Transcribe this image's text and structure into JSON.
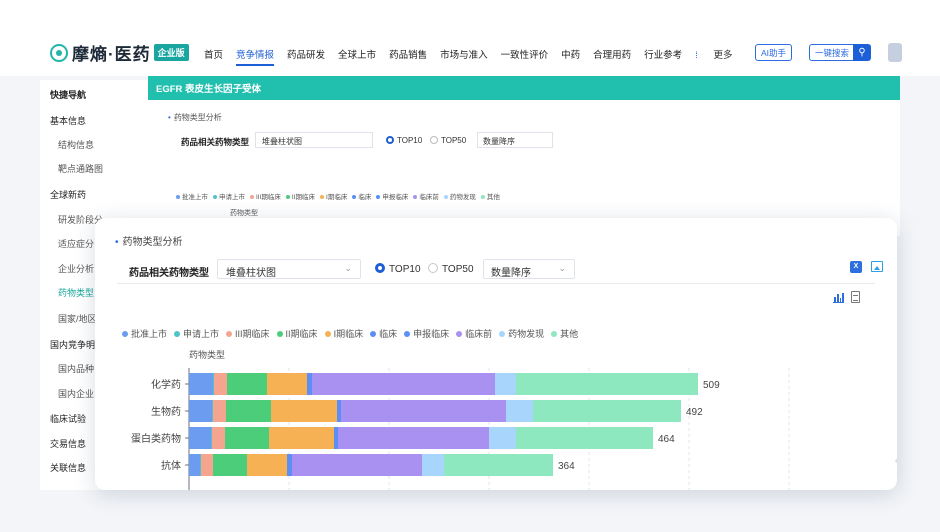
{
  "brand": {
    "name": "摩熵·医药",
    "badge": "企业版"
  },
  "nav": {
    "items": [
      "首页",
      "竞争情报",
      "药品研发",
      "全球上市",
      "药品销售",
      "市场与准入",
      "一致性评价",
      "中药",
      "合理用药",
      "行业参考"
    ],
    "active_index": 1,
    "more_label": "更多"
  },
  "header_actions": {
    "ai_label": "AI助手",
    "search_label": "一键搜索"
  },
  "sidebar": {
    "items": [
      {
        "label": "快捷导航",
        "kind": "head"
      },
      {
        "label": "基本信息",
        "kind": "head"
      },
      {
        "label": "结构信息",
        "kind": "sub"
      },
      {
        "label": "靶点通路图",
        "kind": "sub"
      },
      {
        "label": "全球新药",
        "kind": "head"
      },
      {
        "label": "研发阶段分",
        "kind": "sub"
      },
      {
        "label": "适应症分",
        "kind": "sub"
      },
      {
        "label": "企业分析",
        "kind": "sub"
      },
      {
        "label": "药物类型",
        "kind": "sub",
        "active": true
      },
      {
        "label": "国家/地区",
        "kind": "sub"
      },
      {
        "label": "国内竞争明",
        "kind": "head"
      },
      {
        "label": "国内品种",
        "kind": "sub"
      },
      {
        "label": "国内企业",
        "kind": "sub"
      },
      {
        "label": "临床试验",
        "kind": "head"
      },
      {
        "label": "交易信息",
        "kind": "head"
      },
      {
        "label": "关联信息",
        "kind": "head"
      }
    ]
  },
  "page_header": {
    "title": "EGFR  表皮生长因子受体"
  },
  "section": {
    "title": "药物类型分析",
    "field_label": "药品相关药物类型",
    "chart_select": "堆叠柱状图",
    "top10_label": "TOP10",
    "top50_label": "TOP50",
    "sort_select": "数量降序"
  },
  "colors": {
    "accent": "#21bfae",
    "primary": "#1c5fd6",
    "series": [
      "#6b9cf0",
      "#4fc3c8",
      "#f4a48f",
      "#4ccd7a",
      "#f6b154",
      "#5b8ff5",
      "#5b8ff5",
      "#a891f0",
      "#a8d5fb",
      "#8de8bf"
    ]
  },
  "chart_data": {
    "type": "bar",
    "orientation": "horizontal",
    "stacked": true,
    "title": "",
    "ylabel": "药物类型",
    "categories": [
      "化学药",
      "生物药",
      "蛋白类药物",
      "抗体"
    ],
    "totals": [
      509,
      492,
      464,
      364
    ],
    "xlim": [
      0,
      600
    ],
    "grid": true,
    "legend_position": "top",
    "series": [
      {
        "name": "批准上市",
        "values": [
          24,
          23,
          22,
          11
        ]
      },
      {
        "name": "申请上市",
        "values": [
          1,
          1,
          1,
          1
        ]
      },
      {
        "name": "III期临床",
        "values": [
          13,
          13,
          13,
          12
        ]
      },
      {
        "name": "II期临床",
        "values": [
          40,
          45,
          44,
          34
        ]
      },
      {
        "name": "I期临床",
        "values": [
          40,
          66,
          65,
          40
        ]
      },
      {
        "name": "临床",
        "values": [
          3,
          2,
          2,
          3
        ]
      },
      {
        "name": "申报临床",
        "values": [
          2,
          2,
          2,
          2
        ]
      },
      {
        "name": "临床前",
        "values": [
          183,
          165,
          151,
          130
        ]
      },
      {
        "name": "药物发现",
        "values": [
          21,
          27,
          27,
          22
        ]
      },
      {
        "name": "其他",
        "values": [
          182,
          148,
          137,
          109
        ]
      }
    ]
  }
}
